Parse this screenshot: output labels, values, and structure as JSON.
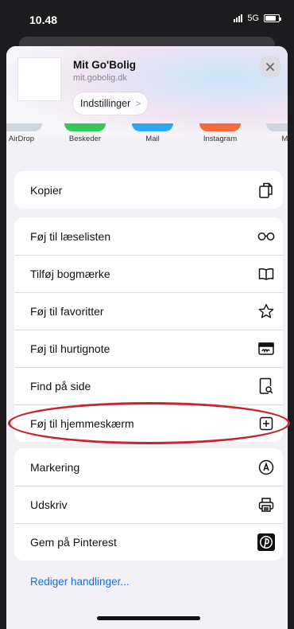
{
  "status_bar": {
    "time": "10.48",
    "network": "5G"
  },
  "header": {
    "title": "Mit Go'Bolig",
    "url": "mit.gobolig.dk",
    "settings_label": "Indstillinger",
    "settings_chevron": ">",
    "close_icon": "close-icon"
  },
  "apps": [
    {
      "label": "AirDrop",
      "color": "#cfd5df"
    },
    {
      "label": "Beskeder",
      "color": "#34c759"
    },
    {
      "label": "Mail",
      "color": "#2ea8f5"
    },
    {
      "label": "Instagram",
      "color": "#f36b3a"
    },
    {
      "label": "Me",
      "color": "#cfd5df"
    }
  ],
  "groups": [
    [
      {
        "label": "Kopier",
        "icon": "copy-icon"
      }
    ],
    [
      {
        "label": "Føj til læselisten",
        "icon": "glasses-icon"
      },
      {
        "label": "Tilføj bogmærke",
        "icon": "book-icon"
      },
      {
        "label": "Føj til favoritter",
        "icon": "star-icon"
      },
      {
        "label": "Føj til hurtignote",
        "icon": "quick-note-icon"
      },
      {
        "label": "Find på side",
        "icon": "find-icon"
      },
      {
        "label": "Føj til hjemmeskærm",
        "icon": "add-square-icon"
      }
    ],
    [
      {
        "label": "Markering",
        "icon": "markup-icon"
      },
      {
        "label": "Udskriv",
        "icon": "printer-icon"
      },
      {
        "label": "Gem på Pinterest",
        "icon": "pinterest-icon"
      }
    ]
  ],
  "edit_actions": "Rediger handlinger...",
  "colors": {
    "link": "#1a6fd4",
    "highlight": "#c3282f"
  }
}
